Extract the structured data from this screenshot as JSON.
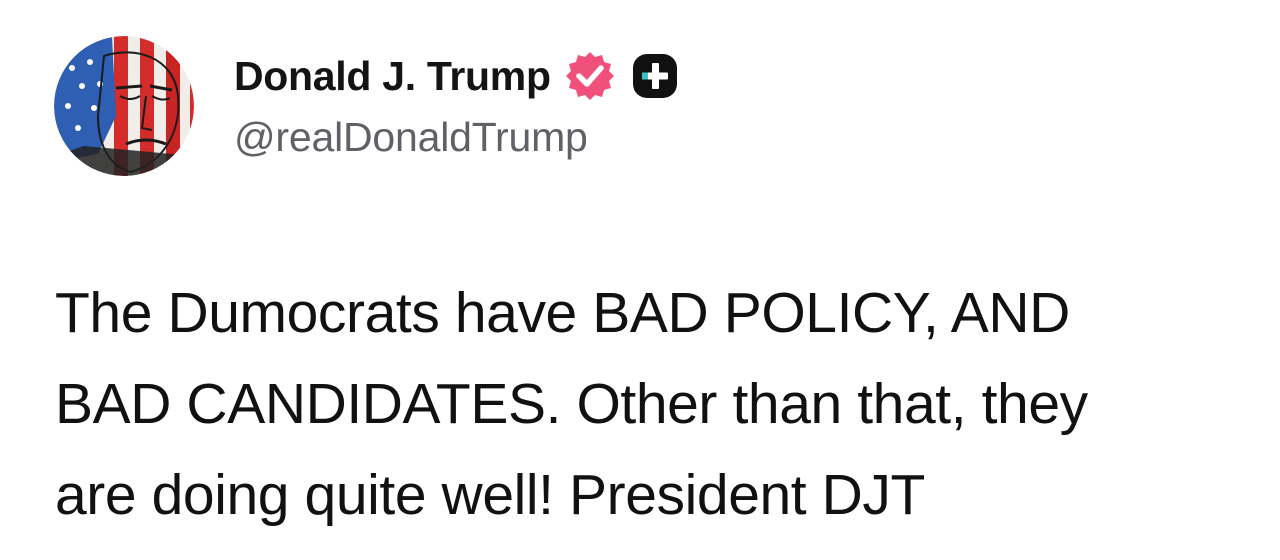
{
  "author": {
    "display_name": "Donald J. Trump",
    "handle": "@realDonaldTrump",
    "avatar_icon": "profile-portrait-flag-avatar",
    "verified_icon": "verified-check-icon",
    "verified_color": "#f0507a",
    "plus_icon": "plus-badge-icon"
  },
  "post": {
    "lines": [
      "The Dumocrats have BAD POLICY, AND",
      "BAD CANDIDATES. Other than that, they",
      "are doing quite well! President DJT"
    ]
  }
}
